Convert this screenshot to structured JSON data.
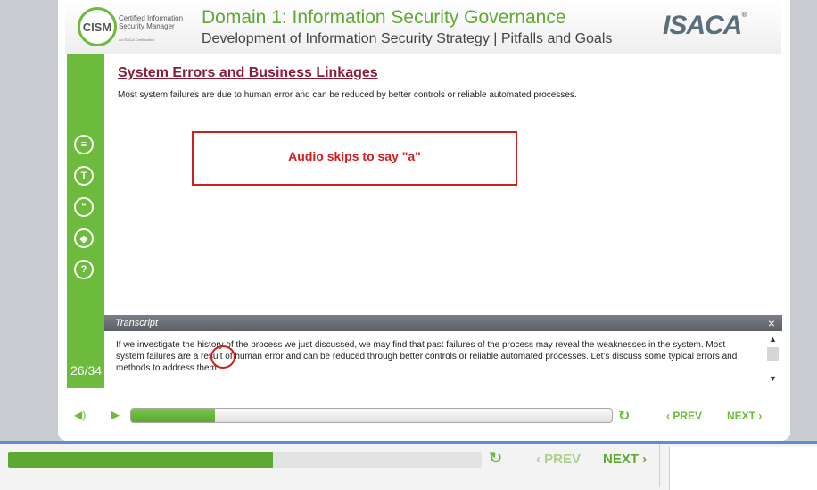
{
  "header": {
    "logo_mark": "CISM",
    "logo_text_line1": "Certified Information",
    "logo_text_line2": "Security Manager",
    "logo_small": "An ISACA Certification",
    "domain_title": "Domain 1: Information Security Governance",
    "subtitle": "Development of Information Security Strategy | Pitfalls and Goals",
    "brand": "ISACA",
    "brand_mark": "®"
  },
  "sidebar": {
    "icons": [
      {
        "name": "notes-icon",
        "glyph": "≡"
      },
      {
        "name": "text-icon",
        "glyph": "T"
      },
      {
        "name": "quote-icon",
        "glyph": "“"
      },
      {
        "name": "layers-icon",
        "glyph": "◈"
      },
      {
        "name": "help-icon",
        "glyph": "?"
      }
    ],
    "slide_counter": "26/34"
  },
  "slide": {
    "title": "System Errors and Business Linkages",
    "body": "Most system failures are due to human error and can be reduced by better controls or reliable automated processes."
  },
  "annotation": {
    "text": "Audio skips to say \"a\"",
    "color": "#d21d1d"
  },
  "transcript": {
    "label": "Transcript",
    "close_glyph": "×",
    "text": "If we investigate the history of the process we just discussed, we may find that past failures of the process may reveal the weaknesses in the system. Most system failures are a result of human error and can be reduced through better controls or reliable automated processes. Let’s discuss some typical errors and methods to address them.",
    "scroll_up": "▲",
    "scroll_down": "▼"
  },
  "player": {
    "volume_glyph": "◀)",
    "play_glyph": "▶",
    "progress": 0.175,
    "replay_glyph": "↻",
    "prev_label": "‹ PREV",
    "next_label": "NEXT ›"
  },
  "bottom_player": {
    "progress": 0.56,
    "replay_glyph": "↻",
    "prev_label": "‹ PREV",
    "next_label": "NEXT ›"
  },
  "colors": {
    "accent_green": "#6dbb3c",
    "title_maroon": "#8a1d3a",
    "annotation_red": "#d21d1d",
    "bottom_border_blue": "#5b8ed6"
  }
}
